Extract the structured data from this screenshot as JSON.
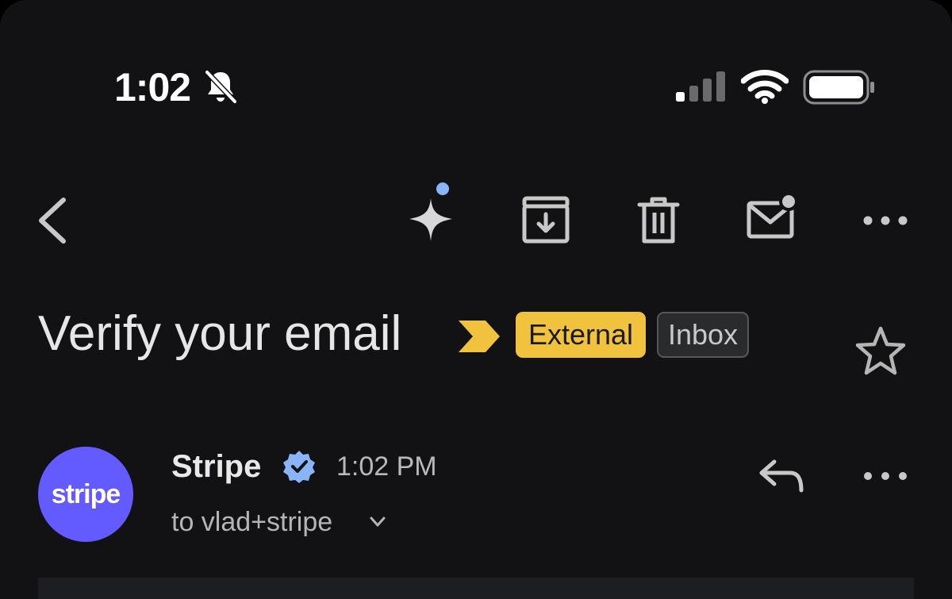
{
  "status_bar": {
    "time": "1:02",
    "icons": [
      "bell-slash-icon",
      "cellular-signal-icon",
      "wifi-icon",
      "battery-icon"
    ]
  },
  "toolbar": {
    "icons": [
      "chevron-left-icon",
      "sparkle-icon",
      "archive-icon",
      "trash-icon",
      "mail-unread-icon",
      "more-horizontal-icon"
    ]
  },
  "email": {
    "subject": "Verify your email",
    "labels": [
      "External",
      "Inbox"
    ],
    "sender": {
      "avatar_text": "stripe",
      "name": "Stripe",
      "time": "1:02 PM",
      "recipient": "to vlad+stripe"
    }
  },
  "colors": {
    "background": "#121214",
    "external_label": "#f1c23d",
    "importance_marker": "#f1c23d",
    "avatar": "#635bff",
    "verified_badge": "#8ab4f8",
    "gemini_dot": "#8ab4f8"
  }
}
